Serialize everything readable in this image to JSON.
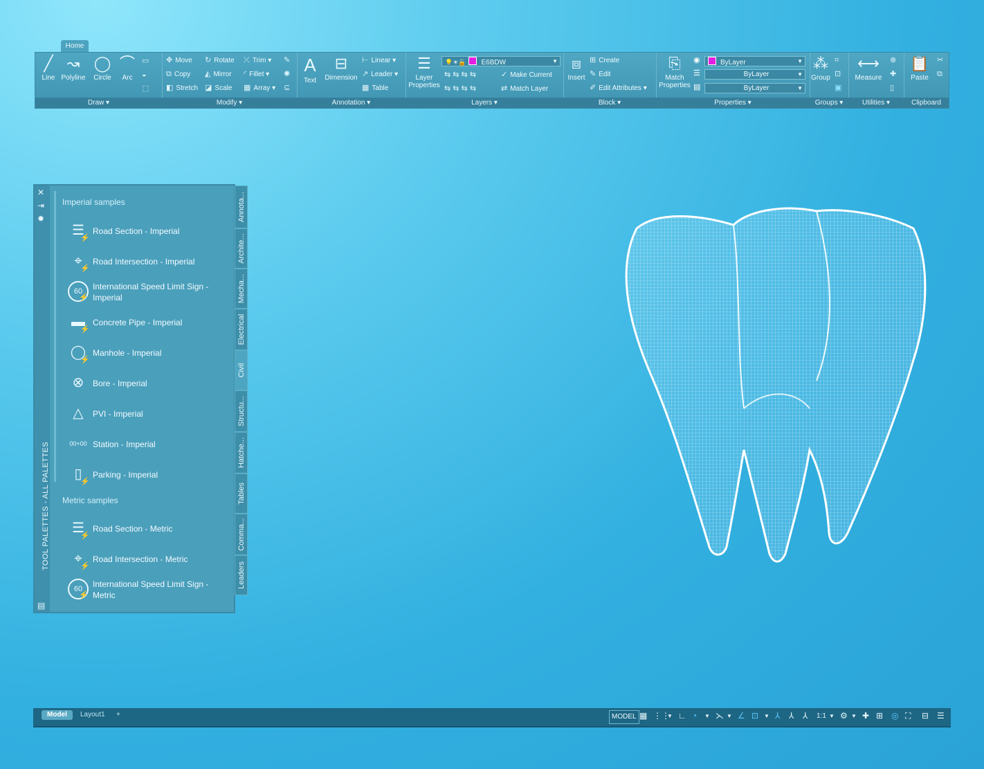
{
  "ribbon": {
    "active_tab": "Home",
    "draw": {
      "title": "Draw",
      "line": "Line",
      "polyline": "Polyline",
      "circle": "Circle",
      "arc": "Arc"
    },
    "modify": {
      "title": "Modify",
      "move": "Move",
      "rotate": "Rotate",
      "trim": "Trim",
      "copy": "Copy",
      "mirror": "Mirror",
      "fillet": "Fillet",
      "stretch": "Stretch",
      "scale": "Scale",
      "array": "Array"
    },
    "annotation": {
      "title": "Annotation",
      "text": "Text",
      "dimension": "Dimension",
      "linear": "Linear",
      "leader": "Leader",
      "table": "Table"
    },
    "layers": {
      "title": "Layers",
      "layer_properties": "Layer Properties",
      "layer_value": "E6BDW",
      "make_current": "Make Current",
      "match_layer": "Match Layer"
    },
    "block": {
      "title": "Block",
      "insert": "Insert",
      "create": "Create",
      "edit": "Edit",
      "edit_attributes": "Edit Attributes"
    },
    "properties": {
      "title": "Properties",
      "match_properties": "Match Properties",
      "color": "ByLayer",
      "linetype": "ByLayer",
      "lineweight": "ByLayer",
      "swatch_color": "#e41ee0"
    },
    "groups": {
      "title": "Groups",
      "group": "Group"
    },
    "utilities": {
      "title": "Utilities",
      "measure": "Measure"
    },
    "clipboard": {
      "title": "Clipboard",
      "paste": "Paste"
    }
  },
  "palette": {
    "title": "TOOL PALETTES - ALL PALETTES",
    "sections": [
      {
        "title": "Imperial samples",
        "items": [
          {
            "label": "Road Section - Imperial",
            "icon": "road-section-icon"
          },
          {
            "label": "Road Intersection - Imperial",
            "icon": "road-intersection-icon"
          },
          {
            "label": "International Speed Limit Sign - Imperial",
            "icon": "speed-limit-sign-icon",
            "badge": "60"
          },
          {
            "label": "Concrete Pipe - Imperial",
            "icon": "concrete-pipe-icon"
          },
          {
            "label": "Manhole - Imperial",
            "icon": "manhole-icon"
          },
          {
            "label": "Bore - Imperial",
            "icon": "bore-icon"
          },
          {
            "label": "PVI - Imperial",
            "icon": "pvi-icon"
          },
          {
            "label": "Station - Imperial",
            "icon": "station-icon",
            "badge": "00+00"
          },
          {
            "label": "Parking - Imperial",
            "icon": "parking-icon"
          }
        ]
      },
      {
        "title": "Metric samples",
        "items": [
          {
            "label": "Road Section - Metric",
            "icon": "road-section-icon"
          },
          {
            "label": "Road Intersection - Metric",
            "icon": "road-intersection-icon"
          },
          {
            "label": "International Speed Limit Sign - Metric",
            "icon": "speed-limit-sign-icon",
            "badge": "60"
          }
        ]
      }
    ],
    "tabs": [
      "Annota...",
      "Archite...",
      "Mecha...",
      "Electrical",
      "Civil",
      "Structu...",
      "Hatche...",
      "Tables",
      "Comma...",
      "Leaders"
    ],
    "active_tab": "Civil"
  },
  "status": {
    "tabs": [
      "Model",
      "Layout1",
      "+"
    ],
    "active_tab": "Model",
    "model_label": "MODEL",
    "scale": "1:1"
  }
}
